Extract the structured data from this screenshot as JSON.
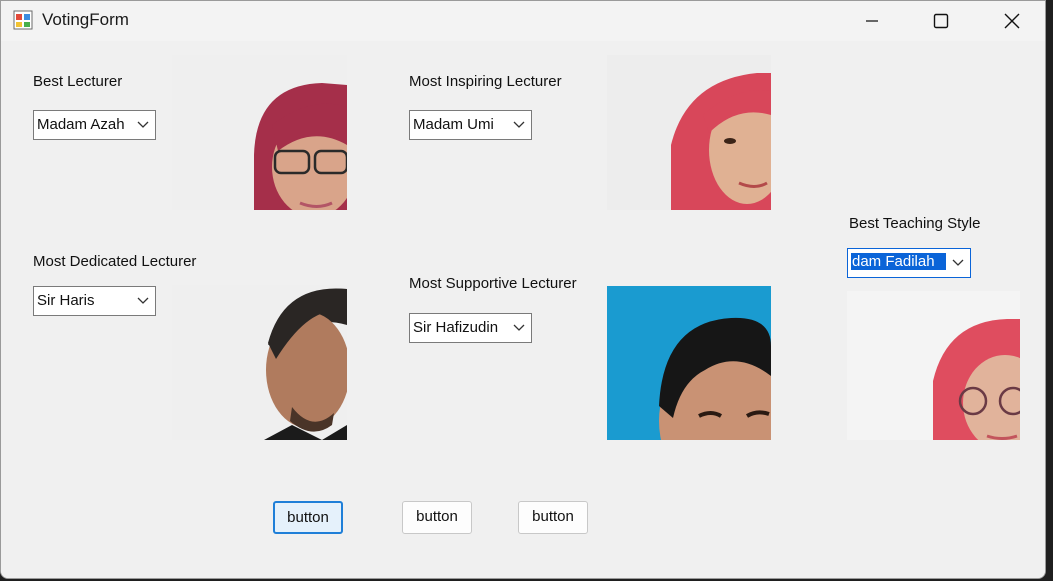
{
  "window": {
    "title": "VotingForm",
    "app_icon": "winforms-app-icon",
    "controls": [
      "minimize-icon",
      "maximize-icon",
      "close-icon"
    ]
  },
  "categories": {
    "best_lecturer": {
      "label": "Best Lecturer",
      "selected": "Madam Azah"
    },
    "most_inspiring": {
      "label": "Most Inspiring Lecturer",
      "selected": "Madam Umi"
    },
    "best_teaching_style": {
      "label": "Best Teaching Style",
      "selected": "dam Fadilah"
    },
    "most_dedicated": {
      "label": "Most Dedicated Lecturer",
      "selected": "Sir Haris"
    },
    "most_supportive": {
      "label": "Most Supportive Lecturer",
      "selected": "Sir Hafizudin"
    }
  },
  "buttons": [
    "button",
    "button",
    "button"
  ],
  "colors": {
    "accent": "#0a64d8",
    "form_bg": "#f0f0f0",
    "photo_blue_bg": "#1a9bd0"
  }
}
